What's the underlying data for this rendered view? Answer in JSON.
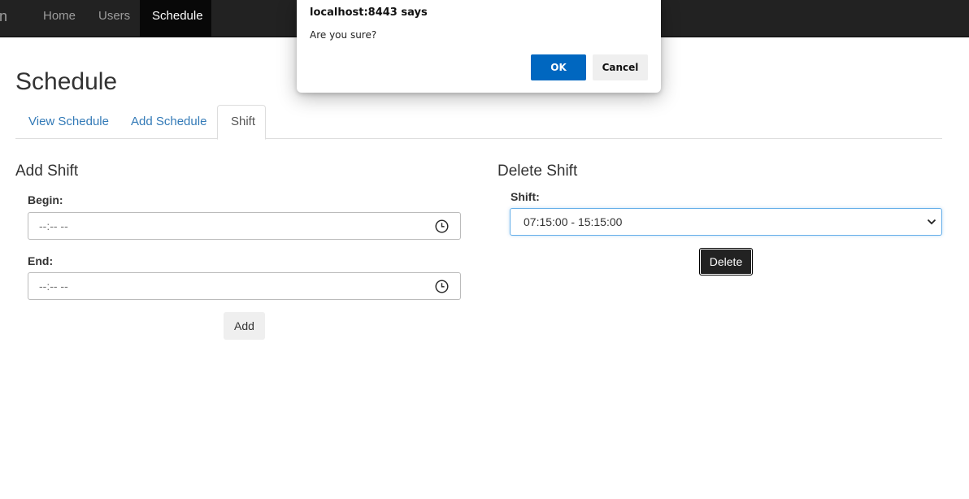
{
  "navbar": {
    "brand": "nin",
    "items": [
      {
        "label": "Home"
      },
      {
        "label": "Users"
      },
      {
        "label": "Schedule"
      }
    ]
  },
  "page": {
    "title": "Schedule"
  },
  "tabs": [
    {
      "label": "View Schedule"
    },
    {
      "label": "Add Schedule"
    },
    {
      "label": "Shift"
    }
  ],
  "add_shift": {
    "title": "Add Shift",
    "begin_label": "Begin:",
    "begin_value": "--:-- --",
    "end_label": "End:",
    "end_value": "--:-- --",
    "add_button": "Add"
  },
  "delete_shift": {
    "title": "Delete Shift",
    "shift_label": "Shift:",
    "selected_shift": "07:15:00 - 15:15:00",
    "delete_button": "Delete"
  },
  "dialog": {
    "title": "localhost:8443 says",
    "message": "Are you sure?",
    "ok_label": "OK",
    "cancel_label": "Cancel"
  },
  "colors": {
    "navbar_bg": "#222222",
    "link": "#337ab7",
    "dialog_ok": "#0067c0"
  }
}
